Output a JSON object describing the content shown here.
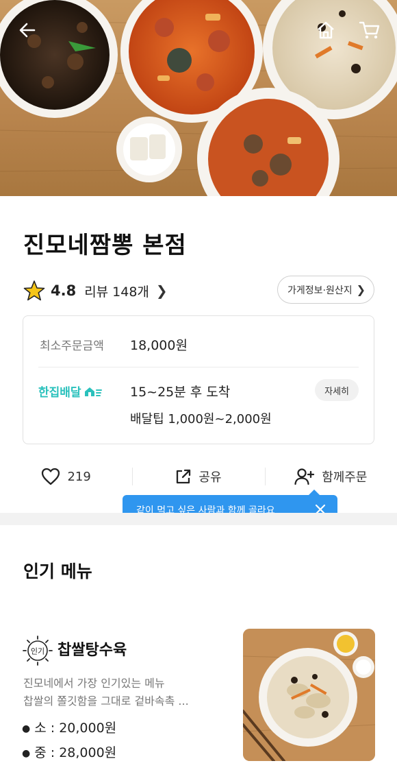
{
  "header": {
    "back_icon": "arrow-left-icon",
    "home_icon": "home-icon",
    "cart_icon": "cart-icon"
  },
  "store": {
    "name": "진모네짬뽕 본점",
    "rating": "4.8",
    "review_label": "리뷰",
    "review_count": "148개",
    "info_button": "가게정보·원산지"
  },
  "order_info": {
    "min_order_label": "최소주문금액",
    "min_order_value": "18,000원",
    "delivery_brand": "한집배달",
    "delivery_time": "15~25분 후 도착",
    "delivery_tip": "배달팁 1,000원~2,000원",
    "detail_button": "자세히"
  },
  "actions": {
    "like_count": "219",
    "share_label": "공유",
    "group_order_label": "함께주문"
  },
  "tooltip": {
    "text": "같이 먹고 싶은 사람과 함께 골라요"
  },
  "popular_menu": {
    "title": "인기 메뉴",
    "items": [
      {
        "badge": "인기",
        "name": "찹쌀탕수육",
        "description_line1": "진모네에서 가장 인기있는 메뉴",
        "description_line2": "찹쌀의 쫄깃함을 그대로 겉바속촉 ...",
        "prices": [
          {
            "size": "소",
            "price": "20,000원"
          },
          {
            "size": "중",
            "price": "28,000원"
          }
        ]
      }
    ]
  },
  "colors": {
    "accent_mint": "#2ac1bc",
    "tooltip_blue": "#2f96ef",
    "star": "#f5c518"
  }
}
